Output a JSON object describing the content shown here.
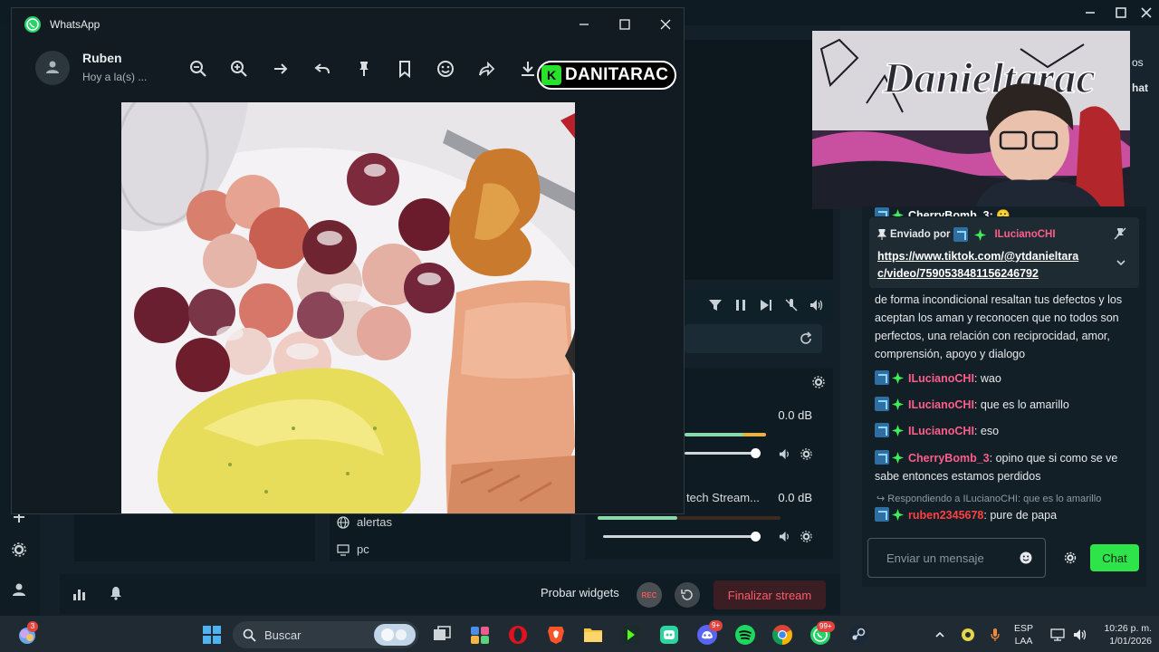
{
  "whatsapp": {
    "app_name": "WhatsApp",
    "contact_name": "Ruben",
    "contact_status": "Hoy a la(s) ...",
    "toolbar_icons": [
      "zoom-out-icon",
      "zoom-in-icon",
      "forward-icon",
      "reply-icon",
      "pin-icon",
      "bookmark-icon",
      "emoji-icon",
      "share-icon",
      "download-icon"
    ]
  },
  "watermark": {
    "badge": "K",
    "text": "DANITARAC"
  },
  "webcam": {
    "graffiti_text": "Danieltarac"
  },
  "right_strip": {
    "label_1": "os",
    "label_2": "hat"
  },
  "mixer": {
    "tracks": [
      {
        "name": "",
        "db": "0.0 dB"
      },
      {
        "name": "tech Stream...",
        "db": "0.0 dB"
      }
    ]
  },
  "sources": {
    "items": [
      {
        "label": "alertas",
        "icon": "globe-icon"
      },
      {
        "label": "pc",
        "icon": "monitor-icon"
      }
    ]
  },
  "bottom_bar": {
    "test_widgets": "Probar widgets",
    "rec": "REC",
    "end_stream": "Finalizar stream"
  },
  "chat": {
    "top_partial": "CherryBomb_3: 😮",
    "pinned": {
      "sent_by": "Enviado por",
      "user": "ILucianoCHI",
      "link_line1": "https://www.tiktok.com/@ytdanieltara",
      "link_line2": "c/video/7590538481156246792"
    },
    "continuation": "de forma incondicional resaltan tus defectos y los aceptan los aman y reconocen que no todos son perfectos, una relación con reciprocidad, amor, comprensión, apoyo y dialogo",
    "messages": [
      {
        "user": "ILucianoCHI",
        "text": "wao"
      },
      {
        "user": "ILucianoCHI",
        "text": "que es lo amarillo"
      },
      {
        "user": "ILucianoCHI",
        "text": "eso"
      },
      {
        "user": "CherryBomb_3",
        "text": "opino que si como se ve sabe entonces estamos perdidos"
      }
    ],
    "reply_hint": "Respondiendo a ILucianoCHI: que es lo amarillo",
    "last_message": {
      "user": "ruben2345678",
      "text": "pure de papa"
    },
    "input_placeholder": "Enviar un mensaje",
    "send_label": "Chat"
  },
  "taskbar": {
    "search_label": "Buscar",
    "lang_line1": "ESP",
    "lang_line2": "LAA",
    "time": "10:26 p. m.",
    "date": "1/01/2026",
    "badges": {
      "copilot": "3",
      "discord": "9+",
      "whatsapp": "99+"
    }
  },
  "colors": {
    "app_bg": "#17242d",
    "whatsapp_bg": "#111b21",
    "accent_green": "#2fe34a",
    "end_stream_red": "#ff5a6a",
    "username_pink": "#ff5e8a"
  }
}
